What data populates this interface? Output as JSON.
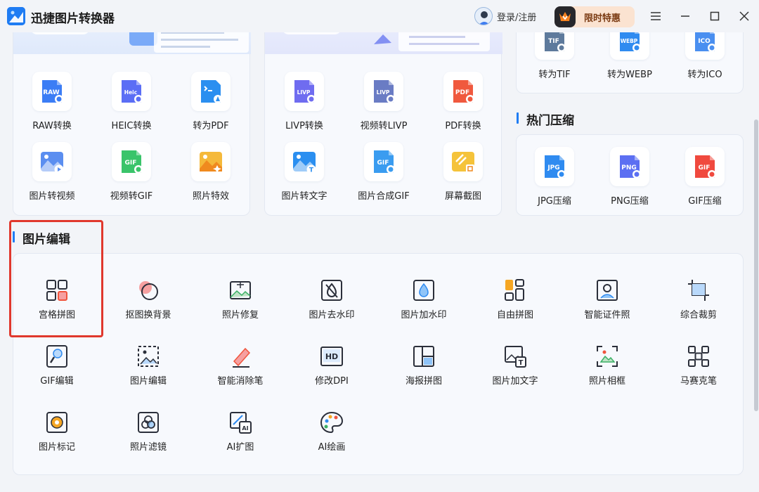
{
  "app": {
    "title": "迅捷图片转换器"
  },
  "header": {
    "login_label": "登录/注册",
    "promo_label": "限时特惠"
  },
  "card_left": {
    "tiles": [
      {
        "label": "RAW转换",
        "icon": "raw-file-icon",
        "badge": "RAW",
        "color": "#3b7df5"
      },
      {
        "label": "HEIC转换",
        "icon": "heic-file-icon",
        "badge": "Heic",
        "color": "#5b6ef5"
      },
      {
        "label": "转为PDF",
        "icon": "to-pdf-icon",
        "badge": "",
        "color": "#2b8ff0"
      },
      {
        "label": "图片转视频",
        "icon": "image-to-video-icon",
        "badge": "",
        "color": "#5b8ef0"
      },
      {
        "label": "视频转GIF",
        "icon": "video-to-gif-icon",
        "badge": "GIF",
        "color": "#3ac46a"
      },
      {
        "label": "照片特效",
        "icon": "photo-effect-icon",
        "badge": "",
        "color": "#f5a623"
      }
    ]
  },
  "card_mid": {
    "tiles": [
      {
        "label": "LIVP转换",
        "icon": "livp-file-icon",
        "badge": "LIVP",
        "color": "#6f6cf0"
      },
      {
        "label": "视频转LIVP",
        "icon": "video-to-livp-icon",
        "badge": "LIVP",
        "color": "#6a7cc4"
      },
      {
        "label": "PDF转换",
        "icon": "pdf-convert-icon",
        "badge": "PDF",
        "color": "#f0593e"
      },
      {
        "label": "图片转文字",
        "icon": "image-to-text-icon",
        "badge": "",
        "color": "#2b8ff0"
      },
      {
        "label": "图片合成GIF",
        "icon": "gif-compose-icon",
        "badge": "GIF",
        "color": "#3a9cf0"
      },
      {
        "label": "屏幕截图",
        "icon": "screenshot-icon",
        "badge": "",
        "color": "#f5a623"
      }
    ]
  },
  "card_right_top": {
    "tiles": [
      {
        "label": "转为TIF",
        "icon": "to-tif-icon",
        "badge": "TIF",
        "color": "#5e7a9c"
      },
      {
        "label": "转为WEBP",
        "icon": "to-webp-icon",
        "badge": "WEBP",
        "color": "#2f8bf0"
      },
      {
        "label": "转为ICO",
        "icon": "to-ico-icon",
        "badge": "ICO",
        "color": "#4a8ff0"
      }
    ]
  },
  "compress": {
    "title": "热门压缩",
    "tiles": [
      {
        "label": "JPG压缩",
        "icon": "jpg-compress-icon",
        "badge": "JPG",
        "color": "#2f8bf0"
      },
      {
        "label": "PNG压缩",
        "icon": "png-compress-icon",
        "badge": "PNG",
        "color": "#5c6ff2"
      },
      {
        "label": "GIF压缩",
        "icon": "gif-compress-icon",
        "badge": "GIF",
        "color": "#f0493e"
      }
    ]
  },
  "edit": {
    "title": "图片编辑",
    "tools": [
      {
        "label": "宫格拼图",
        "icon": "grid-collage-icon"
      },
      {
        "label": "抠图换背景",
        "icon": "cutout-background-icon"
      },
      {
        "label": "照片修复",
        "icon": "photo-repair-icon"
      },
      {
        "label": "图片去水印",
        "icon": "remove-watermark-icon"
      },
      {
        "label": "图片加水印",
        "icon": "add-watermark-icon"
      },
      {
        "label": "自由拼图",
        "icon": "free-collage-icon"
      },
      {
        "label": "智能证件照",
        "icon": "id-photo-icon"
      },
      {
        "label": "综合裁剪",
        "icon": "crop-icon"
      },
      {
        "label": "GIF编辑",
        "icon": "gif-edit-icon"
      },
      {
        "label": "图片编辑",
        "icon": "image-edit-icon"
      },
      {
        "label": "智能消除笔",
        "icon": "eraser-pen-icon"
      },
      {
        "label": "修改DPI",
        "icon": "dpi-icon"
      },
      {
        "label": "海报拼图",
        "icon": "poster-collage-icon"
      },
      {
        "label": "图片加文字",
        "icon": "add-text-icon"
      },
      {
        "label": "照片相框",
        "icon": "photo-frame-icon"
      },
      {
        "label": "马赛克笔",
        "icon": "mosaic-pen-icon"
      },
      {
        "label": "图片标记",
        "icon": "image-mark-icon"
      },
      {
        "label": "照片滤镜",
        "icon": "photo-filter-icon"
      },
      {
        "label": "AI扩图",
        "icon": "ai-expand-icon"
      },
      {
        "label": "AI绘画",
        "icon": "ai-paint-icon"
      }
    ]
  }
}
